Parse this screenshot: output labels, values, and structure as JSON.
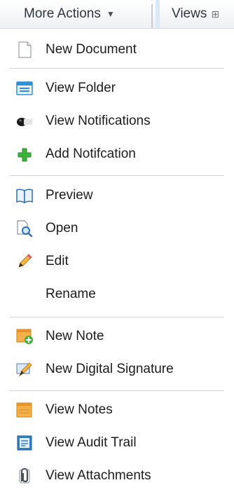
{
  "toolbar": {
    "more_actions_label": "More Actions",
    "more_actions_caret": "▼",
    "views_label": "Views"
  },
  "menu": {
    "items": [
      {
        "label": "New Document",
        "icon": "document-icon"
      },
      {
        "label": "View Folder",
        "icon": "folder-icon"
      },
      {
        "label": "View Notifications",
        "icon": "notification-icon"
      },
      {
        "label": "Add Notifcation",
        "icon": "plus-icon"
      },
      {
        "label": "Preview",
        "icon": "book-icon"
      },
      {
        "label": "Open",
        "icon": "magnify-document-icon"
      },
      {
        "label": "Edit",
        "icon": "pencil-icon"
      },
      {
        "label": "Rename",
        "icon": ""
      },
      {
        "label": "New Note",
        "icon": "new-note-icon"
      },
      {
        "label": "New Digital Signature",
        "icon": "signature-pen-icon"
      },
      {
        "label": "View Notes",
        "icon": "note-icon"
      },
      {
        "label": "View Audit Trail",
        "icon": "audit-trail-icon"
      },
      {
        "label": "View Attachments",
        "icon": "paperclip-icon"
      }
    ]
  },
  "colors": {
    "toolbar_bg": "#eef0f3",
    "divider": "#d2d2d2",
    "plus_green": "#3cb43c",
    "note_orange": "#f2a93b",
    "folder_blue": "#2f8fd8"
  }
}
